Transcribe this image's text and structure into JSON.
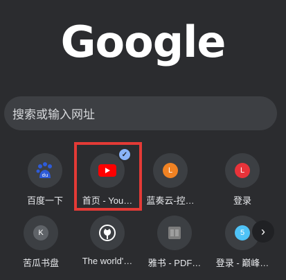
{
  "logo": {
    "text": "Google"
  },
  "search": {
    "placeholder": "搜索或输入网址"
  },
  "shortcuts": [
    {
      "label": "百度一下",
      "icon": "baidu-paw-icon",
      "color": "#2e5bd8"
    },
    {
      "label": "首页 - You…",
      "icon": "youtube-icon",
      "color": "#ff0000"
    },
    {
      "label": "蓝奏云-控…",
      "icon_letter": "L",
      "color": "#f08223"
    },
    {
      "label": "登录",
      "icon_letter": "L",
      "color": "#e8333a"
    },
    {
      "label": "苦瓜书盘",
      "icon_letter": "K",
      "color": "#5f6368"
    },
    {
      "label": "The world'…",
      "icon": "github-icon",
      "color": "#ffffff"
    },
    {
      "label": "雅书 - PDF…",
      "icon": "book-icon",
      "color": "#7d7d7d"
    },
    {
      "label": "登录 - 巅峰…",
      "icon_letter": "5",
      "color": "#4fc3f7"
    }
  ],
  "badge": {
    "icon": "check-icon",
    "color": "#8ab4f8"
  },
  "highlight_color": "#e33a36",
  "next_button": {
    "icon": "chevron-right-icon"
  }
}
